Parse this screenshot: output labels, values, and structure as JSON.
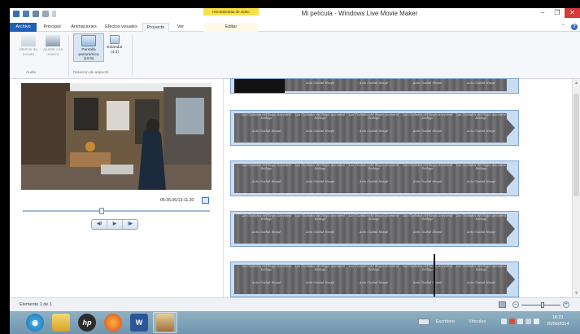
{
  "window": {
    "title": "Mi película - Windows Live Movie Maker",
    "contextual_tab_group": "Herramientas de vídeo",
    "minimize": "–",
    "maximize": "❐",
    "close": "✕"
  },
  "tabs": {
    "archivo": "Archivo",
    "principal": "Principal",
    "animaciones": "Animaciones",
    "efectos": "Efectos visuales",
    "proyecto": "Proyecto",
    "ver": "Ver",
    "editar": "Editar"
  },
  "ribbon": {
    "mezcla": "Mezcla de sonido",
    "ajustar": "Ajustar a la música",
    "pantalla": "Pantalla panorámica (16:9)",
    "estandar": "Estándar (4:3)",
    "group_audio": "Audio",
    "group_aspecto": "Relación de aspecto"
  },
  "player": {
    "timecode": "05:35,06/13:11,30",
    "prev": "◀I",
    "play": "▶",
    "next": "I▶",
    "seek_fraction": 0.42
  },
  "storyboard": {
    "caption_line1": "Las Ciudades del Regio Ancestral Diálogo",
    "caption_line2": "Acto Ciudad Hospé"
  },
  "status": {
    "text": "Elemento 1 de 1",
    "zoom_fraction": 0.55
  },
  "taskbar": {
    "hp_label": "hp",
    "word_label": "W",
    "escritorio": "Escritorio",
    "vinculos": "Vínculos",
    "time": "18:21",
    "date": "20/06/2014"
  },
  "colors": {
    "accent": "#1f5fb4",
    "contextual_tab": "#f8e04a",
    "close_button": "#d9383a",
    "storyboard_frame": "#c8dcf2"
  }
}
